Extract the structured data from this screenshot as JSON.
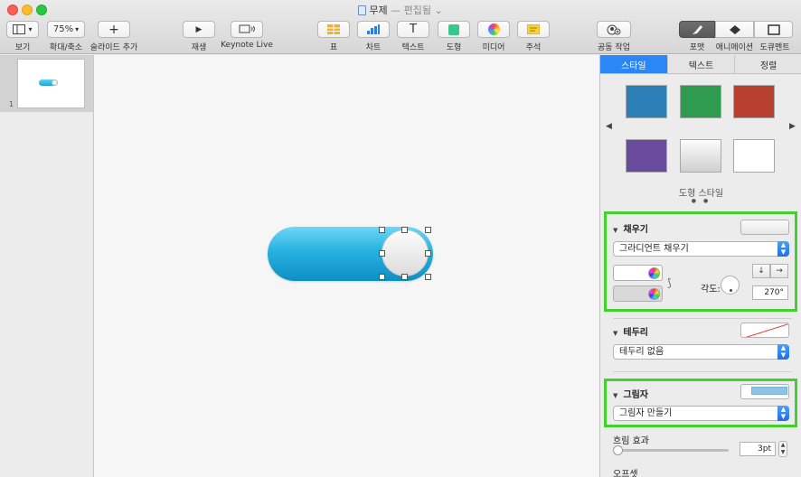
{
  "window": {
    "title": "무제",
    "separator": "—",
    "edited_label": "편집됨",
    "title_chevron": "⌄"
  },
  "toolbar": {
    "view": {
      "label": "보기",
      "glyph": "▾"
    },
    "zoom": {
      "value": "75%",
      "label": "확대/축소"
    },
    "add_slide": {
      "label": "슬라이드 추가",
      "glyph": "+"
    },
    "play": {
      "label": "재생",
      "glyph": "▶"
    },
    "keynote_live": {
      "label": "Keynote Live"
    },
    "table": {
      "label": "표"
    },
    "chart": {
      "label": "차트"
    },
    "text": {
      "label": "텍스트",
      "glyph": "T"
    },
    "shape": {
      "label": "도형"
    },
    "media": {
      "label": "미디어"
    },
    "comment": {
      "label": "주석"
    },
    "collaborate": {
      "label": "공동 작업"
    },
    "format": {
      "label": "포맷"
    },
    "animate": {
      "label": "애니메이션"
    },
    "document": {
      "label": "도큐멘트"
    }
  },
  "navigator": {
    "slides": [
      {
        "number": "1"
      }
    ]
  },
  "inspector": {
    "tabs": [
      {
        "label": "스타일",
        "active": true
      },
      {
        "label": "텍스트",
        "active": false
      },
      {
        "label": "정렬",
        "active": false
      }
    ],
    "shape_styles": {
      "label": "도형 스타일",
      "prev_glyph": "◀",
      "next_glyph": "▶",
      "page_dots": "● ●",
      "swatches": [
        "blue",
        "green",
        "red",
        "purple",
        "gradient",
        "white"
      ]
    },
    "fill": {
      "title": "채우기",
      "type": "그라디언트 채우기",
      "color_start": "#ffffff",
      "color_end": "#d9d9d9",
      "angle_label": "각도:",
      "angle_value": "270°"
    },
    "border": {
      "title": "테두리",
      "type": "테두리 없음"
    },
    "shadow": {
      "title": "그림자",
      "type": "그림자 만들기",
      "blur_label": "흐림 효과",
      "blur_value": "3pt",
      "offset_label": "오프셋"
    }
  },
  "colors": {
    "accent": "#2a87f5",
    "highlight_box": "#43d12d",
    "pill_top": "#6fd7f7",
    "pill_bottom": "#0e8fc4"
  }
}
